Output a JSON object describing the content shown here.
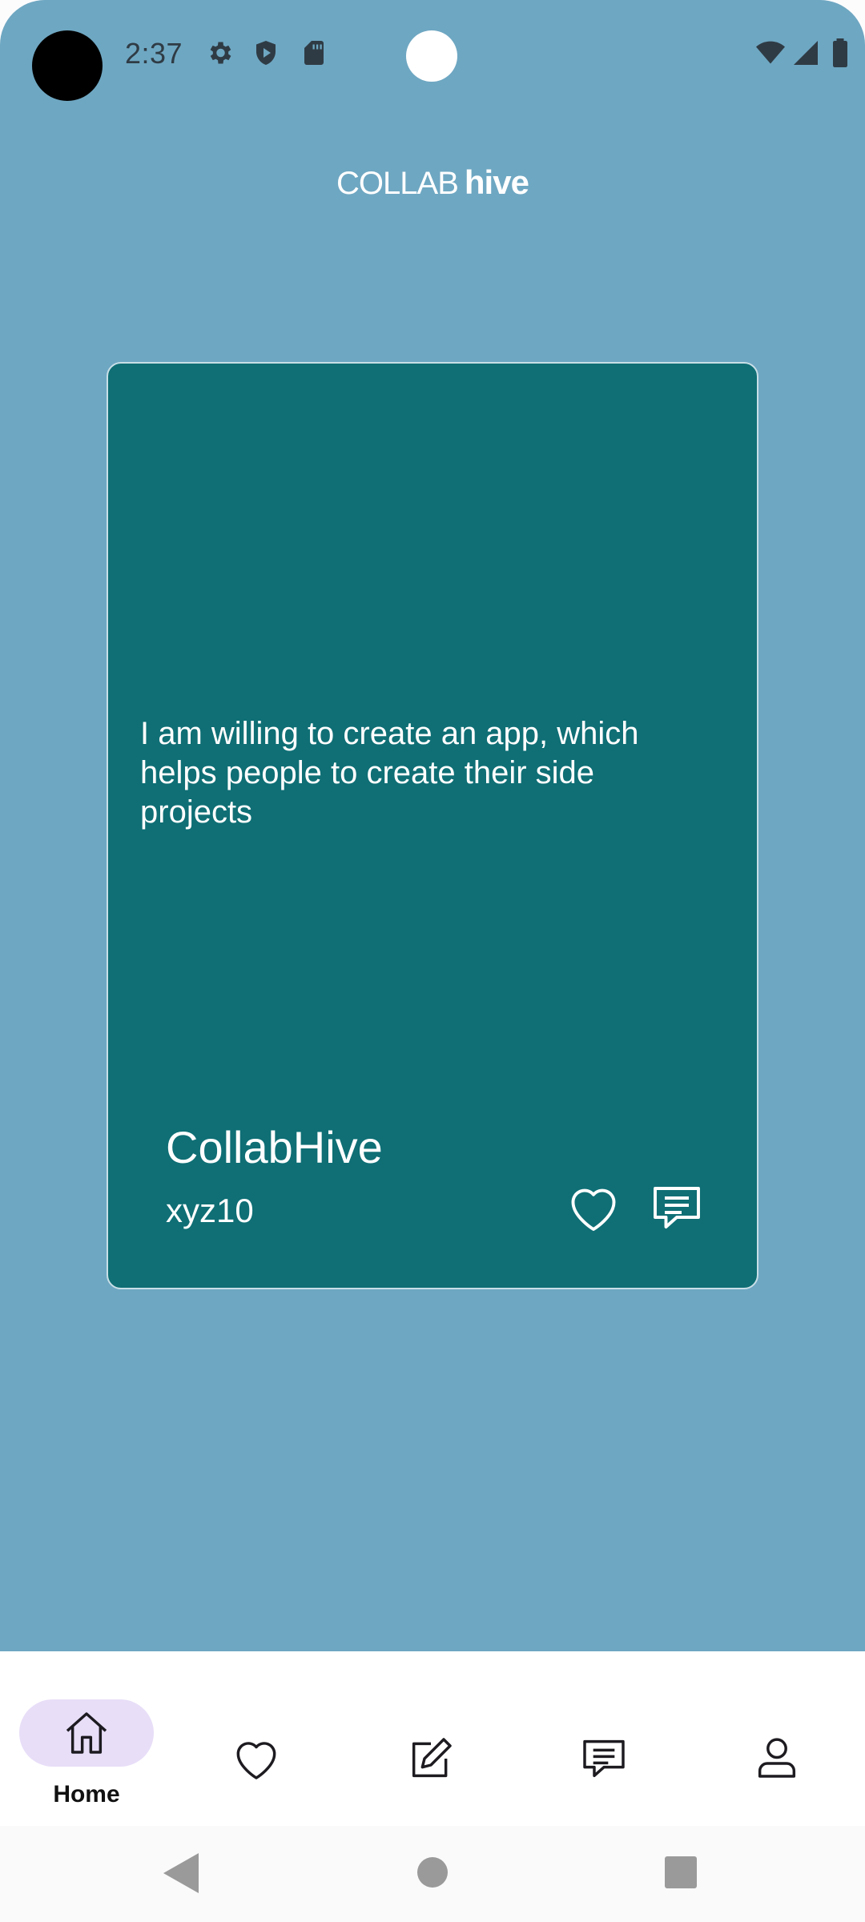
{
  "status_bar": {
    "time": "2:37",
    "icons": [
      "settings-icon",
      "shield-icon",
      "sd-card-icon",
      "wifi-icon",
      "signal-icon",
      "battery-icon"
    ]
  },
  "header": {
    "logo_part1": "COLLAB",
    "logo_part2": "hive"
  },
  "card": {
    "description": "I am willing to create an app, which helps people to create their side projects",
    "title": "CollabHive",
    "username": "xyz10",
    "actions": [
      "heart-icon",
      "comment-icon"
    ]
  },
  "bottom_nav": {
    "items": [
      {
        "label": "Home",
        "icon": "home-icon",
        "selected": true
      },
      {
        "label": "",
        "icon": "heart-icon",
        "selected": false
      },
      {
        "label": "",
        "icon": "edit-icon",
        "selected": false
      },
      {
        "label": "",
        "icon": "chat-icon",
        "selected": false
      },
      {
        "label": "",
        "icon": "profile-icon",
        "selected": false
      }
    ]
  },
  "colors": {
    "background": "#6ea7c2",
    "card": "#0f6f75",
    "nav_selected_pill": "#e8def8",
    "text_on_card": "#ffffff"
  }
}
